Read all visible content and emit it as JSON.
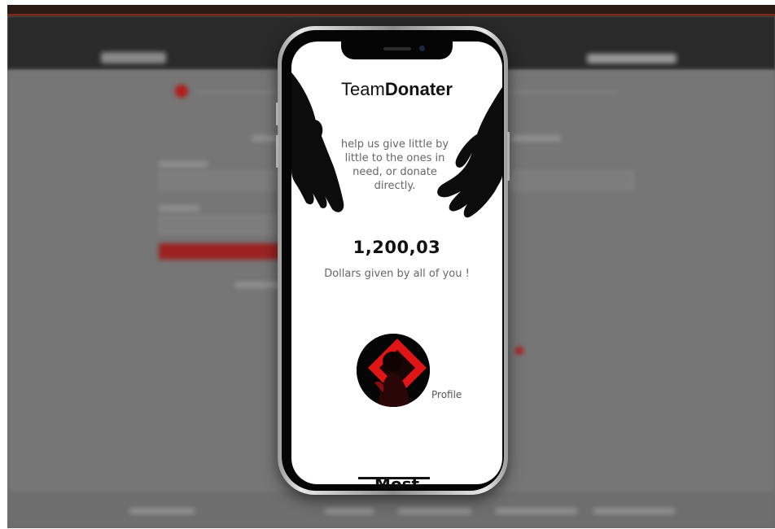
{
  "app": {
    "brand_light": "Team",
    "brand_bold": "Donater",
    "tagline": "help us give little by little to the ones in need, or donate directly.",
    "total_amount": "1,200,03",
    "total_label": "Dollars given by all of you !",
    "profile_label": "Profile",
    "section_heading_cut": "Most"
  },
  "icons": {
    "left_hand": "reaching-hand-icon",
    "right_hand": "open-hand-icon",
    "avatar": "profile-avatar"
  },
  "colors": {
    "accent": "#e01515",
    "text_dark": "#111111",
    "text_muted": "#666666"
  }
}
